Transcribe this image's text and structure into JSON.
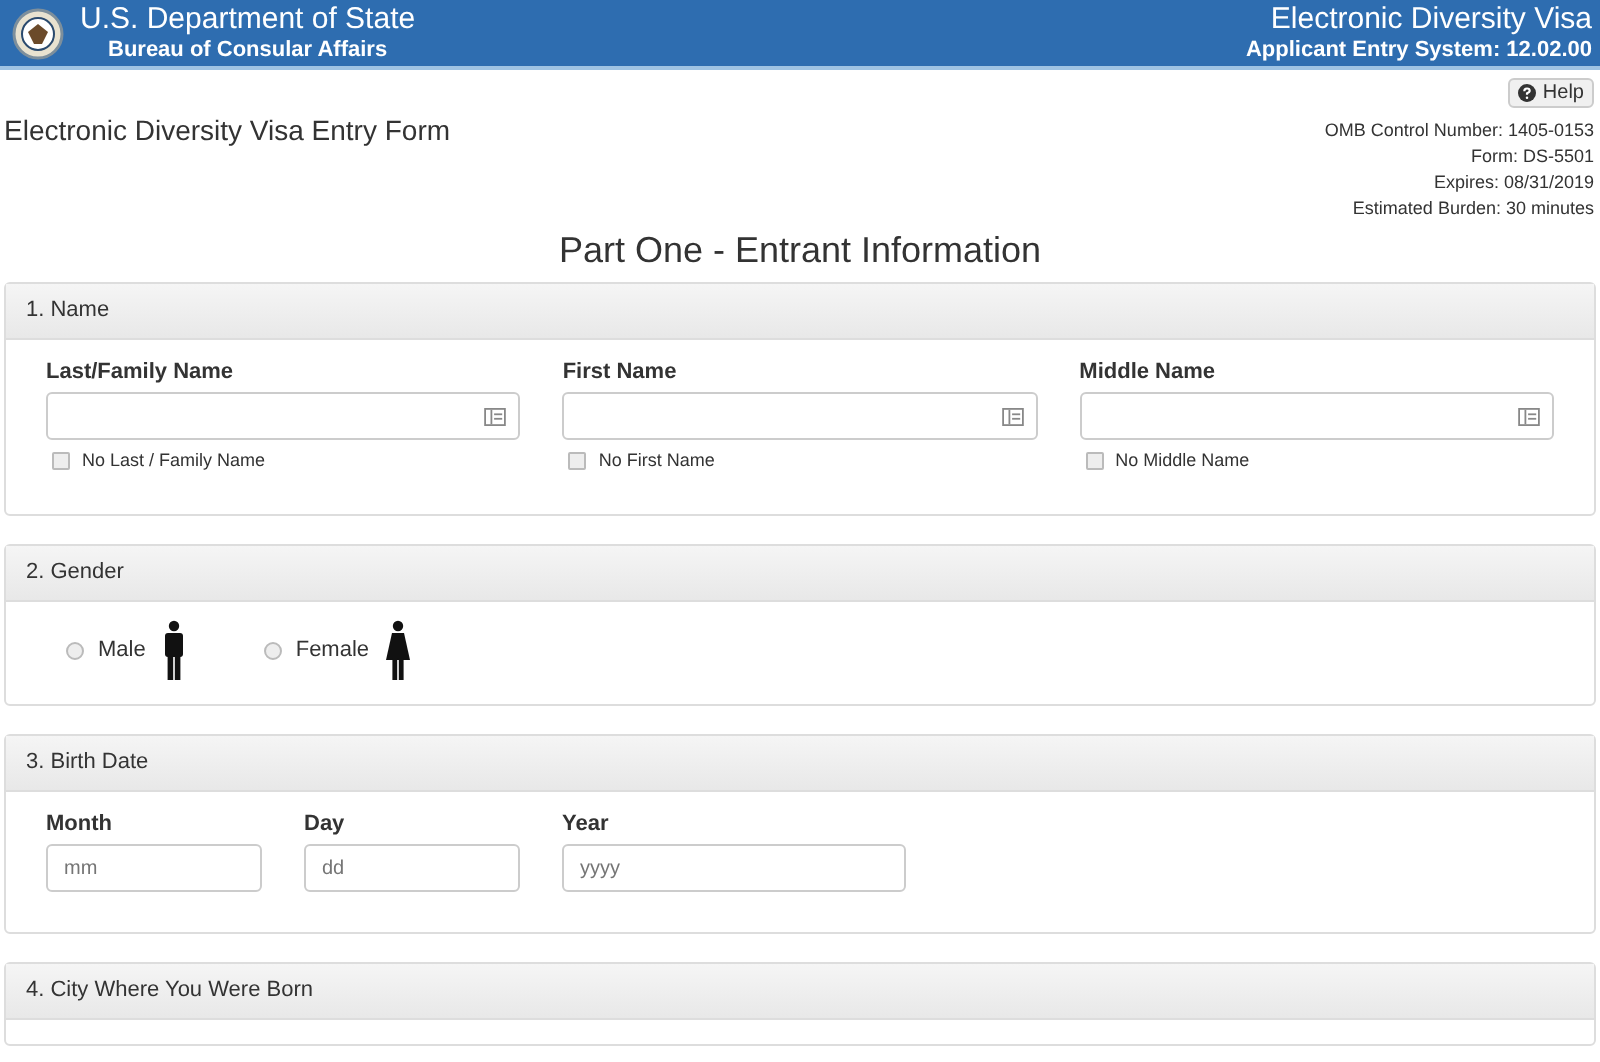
{
  "header": {
    "title": "U.S. Department of State",
    "subtitle": "Bureau of Consular Affairs",
    "app_title": "Electronic Diversity Visa",
    "app_version": "Applicant Entry System: 12.02.00"
  },
  "help_button": {
    "label": "Help"
  },
  "form_title": "Electronic Diversity Visa Entry Form",
  "meta": [
    "OMB Control Number: 1405-0153",
    "Form: DS-5501",
    "Expires: 08/31/2019",
    "Estimated Burden: 30 minutes"
  ],
  "part_title": "Part One - Entrant Information",
  "name_section": {
    "heading": "1. Name",
    "fields": [
      {
        "label": "Last/Family Name",
        "checkbox": "No Last / Family Name",
        "checked": false
      },
      {
        "label": "First Name",
        "checkbox": "No First Name",
        "checked": false
      },
      {
        "label": "Middle Name",
        "checkbox": "No Middle Name",
        "checked": false
      }
    ]
  },
  "gender_section": {
    "heading": "2. Gender",
    "options": [
      {
        "label": "Male",
        "kind": "male",
        "selected": false
      },
      {
        "label": "Female",
        "kind": "female",
        "selected": false
      }
    ]
  },
  "birth_section": {
    "heading": "3. Birth Date",
    "fields": [
      {
        "label": "Month",
        "placeholder": "mm",
        "kind": "short"
      },
      {
        "label": "Day",
        "placeholder": "dd",
        "kind": "short"
      },
      {
        "label": "Year",
        "placeholder": "yyyy",
        "kind": "long"
      }
    ]
  },
  "city_section": {
    "heading": "4. City Where You Were Born"
  }
}
